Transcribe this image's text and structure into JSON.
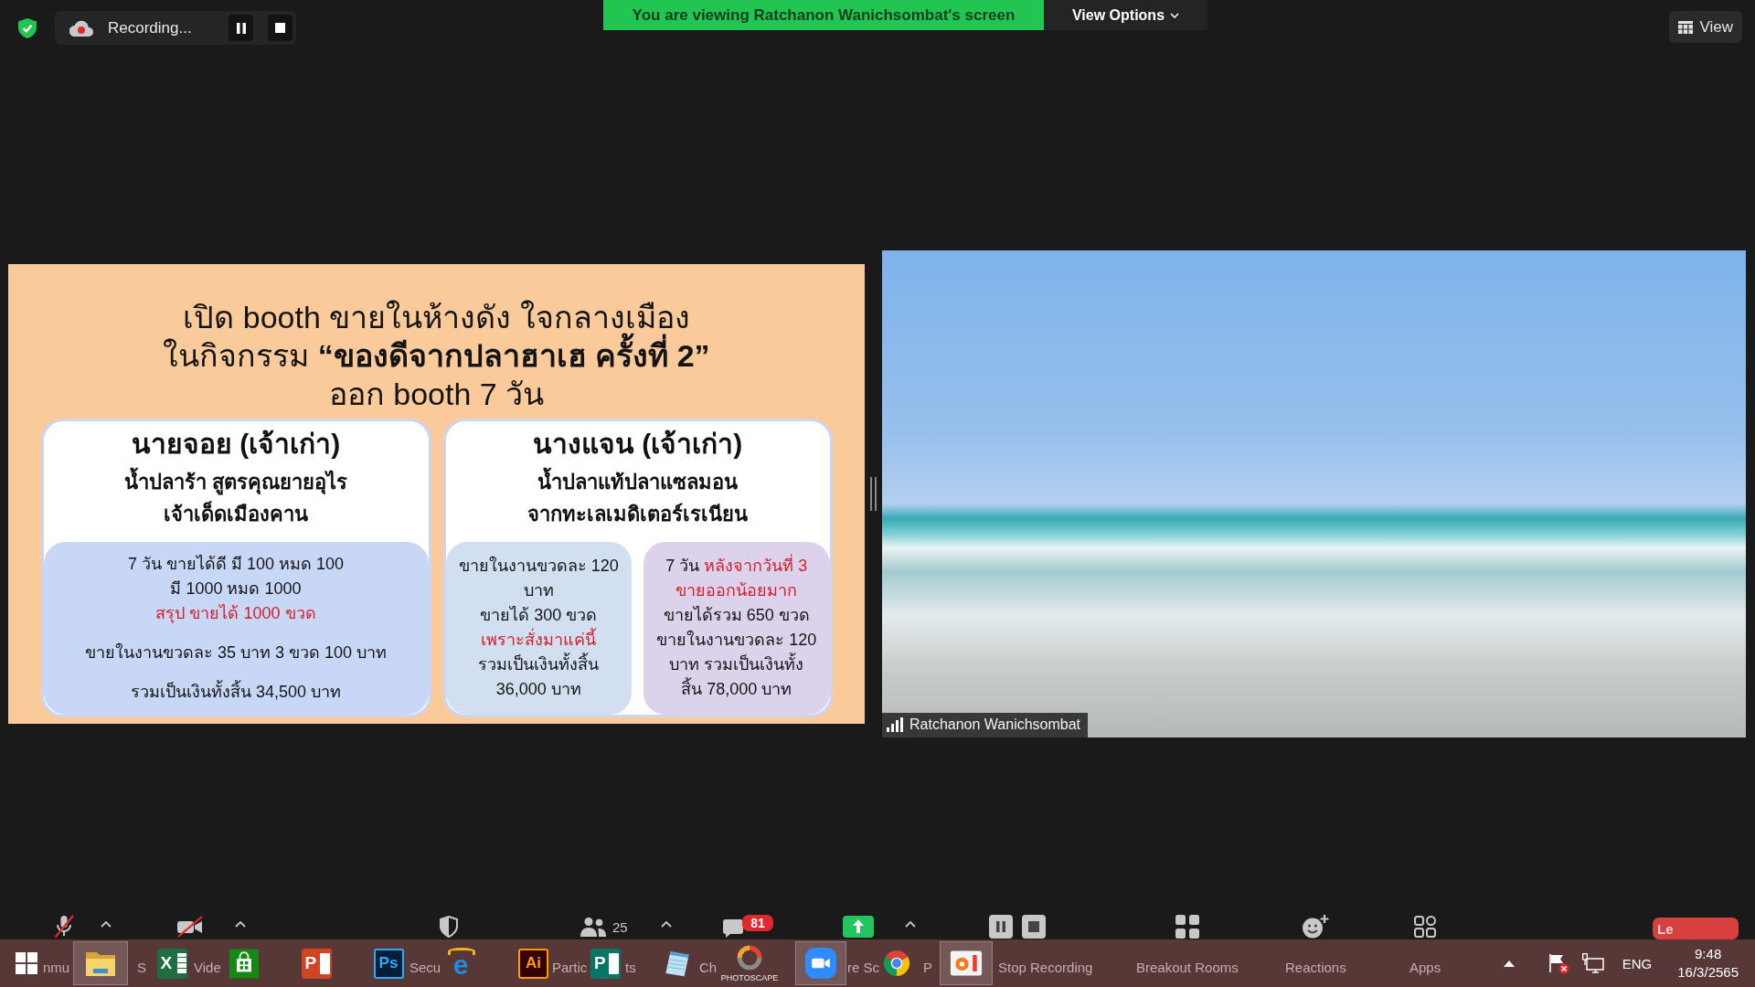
{
  "top_bar": {
    "recording_status": "Recording...",
    "banner": "You are viewing Ratchanon Wanichsombat's screen",
    "view_options": "View Options",
    "view_button": "View"
  },
  "slide": {
    "title_lines": [
      "เปิด booth ขายในห้างดัง ใจกลางเมือง",
      "ในกิจกรรม **“ของดีจากปลาฮาเฮ ครั้งที่ 2”**",
      "ออก booth 7 วัน"
    ],
    "cards": [
      {
        "heading": "นายจอย (เจ้าเก่า)",
        "subheading_lines": [
          "น้ำปลาร้า สูตรคุณยายอุไร",
          "เจ้าเด็ดเมืองคาน"
        ],
        "boxes": [
          {
            "color": "#c9d7f6",
            "paragraphs": [
              {
                "lines": [
                  [
                    {
                      "text": "7 วัน ขายได้ดี มี 100 หมด 100",
                      "emphasis": false
                    }
                  ],
                  [
                    {
                      "text": "มี 1000 หมด 1000",
                      "emphasis": false
                    }
                  ],
                  [
                    {
                      "text": "สรุป ขายได้ 1000 ขวด",
                      "emphasis": true
                    }
                  ]
                ]
              },
              {
                "lines": [
                  [
                    {
                      "text": "ขายในงานขวดละ 35 บาท 3 ขวด 100 บาท",
                      "emphasis": false
                    }
                  ]
                ]
              },
              {
                "lines": [
                  [
                    {
                      "text": "รวมเป็นเงินทั้งสิ้น 34,500 บาท",
                      "emphasis": false
                    }
                  ]
                ]
              }
            ]
          }
        ]
      },
      {
        "heading": "นางแจน (เจ้าเก่า)",
        "subheading_lines": [
          "น้ำปลาแท้ปลาแซลมอน",
          "จากทะเลเมดิเตอร์เรเนียน"
        ],
        "boxes": [
          {
            "color": "#d2dff0",
            "paragraphs": [
              {
                "lines": [
                  [
                    {
                      "text": "ขายในงานขวดละ 120",
                      "emphasis": false
                    }
                  ],
                  [
                    {
                      "text": "บาท",
                      "emphasis": false
                    }
                  ],
                  [
                    {
                      "text": "ขายได้ 300 ขวด",
                      "emphasis": false
                    }
                  ],
                  [
                    {
                      "text": "เพราะสั่งมาแค่นี้",
                      "emphasis": true
                    }
                  ],
                  [
                    {
                      "text": "รวมเป็นเงินทั้งสิ้น",
                      "emphasis": false
                    }
                  ],
                  [
                    {
                      "text": "36,000 บาท",
                      "emphasis": false
                    }
                  ]
                ]
              }
            ]
          },
          {
            "color": "#dcd2ec",
            "paragraphs": [
              {
                "lines": [
                  [
                    {
                      "text": "7 วัน ",
                      "emphasis": false
                    },
                    {
                      "text": "หลังจากวันที่ 3",
                      "emphasis": true
                    }
                  ],
                  [
                    {
                      "text": "ขายออกน้อยมาก",
                      "emphasis": true
                    }
                  ],
                  [
                    {
                      "text": "ขายได้รวม 650 ขวด",
                      "emphasis": false
                    }
                  ],
                  [
                    {
                      "text": "ขายในงานขวดละ 120",
                      "emphasis": false
                    }
                  ],
                  [
                    {
                      "text": "บาท รวมเป็นเงินทั้ง",
                      "emphasis": false
                    }
                  ],
                  [
                    {
                      "text": "สิ้น 78,000 บาท",
                      "emphasis": false
                    }
                  ]
                ]
              }
            ]
          }
        ]
      }
    ]
  },
  "video": {
    "participant_name": "Ratchanon Wanichsombat"
  },
  "meeting_controls": [
    {
      "kind": "unmute",
      "label_parts": [
        "nmu"
      ],
      "caret": true
    },
    {
      "kind": "start_video",
      "label_parts": [
        "S",
        "Vide"
      ],
      "caret": true
    },
    {
      "kind": "security",
      "label_parts": [
        "Secu"
      ],
      "caret": false
    },
    {
      "kind": "participants",
      "count": "25",
      "label_parts": [
        "Partic",
        "ts"
      ],
      "caret": true
    },
    {
      "kind": "chat",
      "badge": "81",
      "label_parts": [
        "Ch"
      ],
      "caret": false
    },
    {
      "kind": "share_screen",
      "label_parts": [
        "re Sc"
      ],
      "caret": true
    },
    {
      "kind": "recording",
      "label_parts": [
        "P",
        "Stop Recording"
      ],
      "caret": false
    },
    {
      "kind": "breakout_rooms",
      "label_parts": [
        "Breakout Rooms"
      ],
      "caret": false
    },
    {
      "kind": "reactions",
      "label_parts": [
        "Reactions"
      ],
      "caret": false
    },
    {
      "kind": "apps",
      "label_parts": [
        "Apps"
      ],
      "caret": false
    },
    {
      "kind": "leave",
      "label_parts": [
        "Le"
      ],
      "caret": false
    }
  ],
  "taskbar": {
    "apps": [
      {
        "kind": "start",
        "active": false
      },
      {
        "kind": "file_explorer",
        "active": true
      },
      {
        "kind": "spreadsheet",
        "glyph": "X",
        "active": false
      },
      {
        "kind": "store",
        "active": false
      },
      {
        "kind": "slides",
        "glyph": "P",
        "active": false
      },
      {
        "kind": "photo_editor",
        "glyph": "Ps",
        "active": false
      },
      {
        "kind": "e_browser",
        "glyph": "e",
        "active": false
      },
      {
        "kind": "vector_editor",
        "glyph": "Ai",
        "active": false
      },
      {
        "kind": "publisher",
        "glyph": "P",
        "active": false
      },
      {
        "kind": "notepad",
        "active": false
      },
      {
        "kind": "photoscape",
        "caption": "PHOTOSCAPE",
        "active": false
      },
      {
        "kind": "video_meeting",
        "active": true
      },
      {
        "kind": "web_browser",
        "active": false
      },
      {
        "kind": "screen_recorder",
        "active": true
      }
    ],
    "tray": {
      "language": "ENG",
      "time": "9:48",
      "date": "16/3/2565"
    }
  }
}
